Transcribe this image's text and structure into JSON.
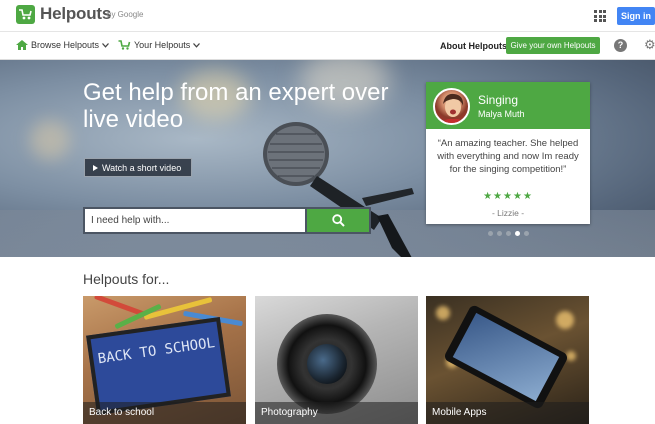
{
  "header": {
    "logo_text": "Helpouts",
    "logo_by": "by Google",
    "signin_label": "Sign in"
  },
  "nav": {
    "browse_label": "Browse Helpouts",
    "yours_label": "Your Helpouts",
    "about_label": "About Helpouts",
    "give_label": "Give your own Helpouts",
    "help_glyph": "?",
    "settings_glyph": "⚙"
  },
  "hero": {
    "title": "Get help from an expert over live video",
    "video_label": "Watch a short video",
    "search_placeholder": "I need help with..."
  },
  "testimonial": {
    "category": "Singing",
    "expert": "Malya Muth",
    "quote": "“An amazing teacher. She helped with everything and now Im ready for the singing competition!”",
    "stars": "★★★★★",
    "author": "- Lizzie -",
    "dot_count": 5,
    "active_dot": 3
  },
  "section": {
    "title": "Helpouts for..."
  },
  "tiles": [
    {
      "label": "Back to school",
      "art_text": "BACK TO SCHOOL"
    },
    {
      "label": "Photography"
    },
    {
      "label": "Mobile Apps"
    }
  ],
  "colors": {
    "brand_green": "#4ea843",
    "signin_blue": "#4285f4"
  }
}
